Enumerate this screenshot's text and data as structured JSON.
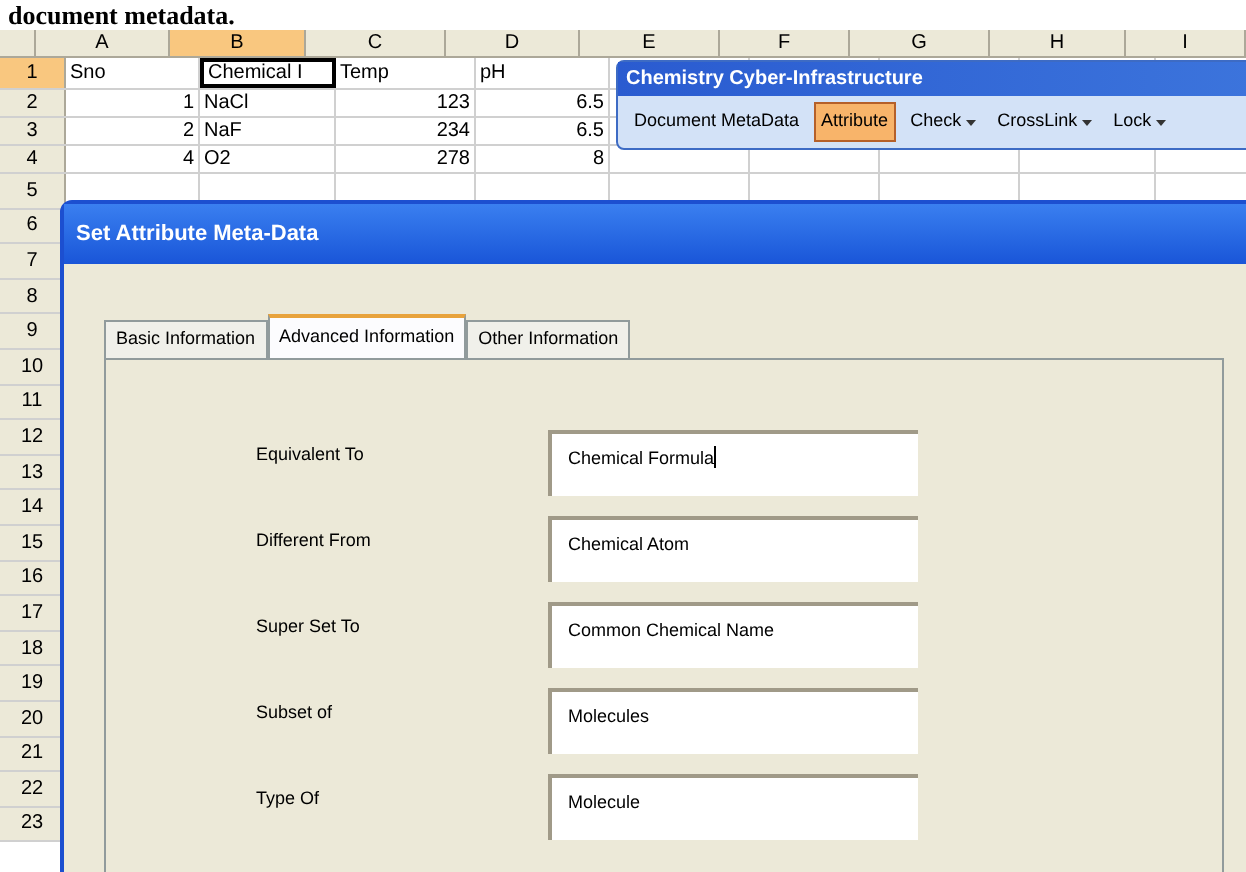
{
  "caption": "document metadata.",
  "sheet": {
    "columns": [
      {
        "label": "A",
        "selected": false
      },
      {
        "label": "B",
        "selected": true
      },
      {
        "label": "C",
        "selected": false
      },
      {
        "label": "D",
        "selected": false
      },
      {
        "label": "E",
        "selected": false
      },
      {
        "label": "F",
        "selected": false
      },
      {
        "label": "G",
        "selected": false
      },
      {
        "label": "H",
        "selected": false
      },
      {
        "label": "I",
        "selected": false
      }
    ],
    "rows": [
      {
        "number": "1",
        "selected": true,
        "cells": [
          {
            "text": "Sno",
            "kind": "text",
            "active": false
          },
          {
            "text": "Chemical I",
            "kind": "text",
            "active": true
          },
          {
            "text": "Temp",
            "kind": "text",
            "active": false
          },
          {
            "text": "pH",
            "kind": "text",
            "active": false
          }
        ]
      },
      {
        "number": "2",
        "selected": false,
        "cells": [
          {
            "text": "1",
            "kind": "number",
            "active": false
          },
          {
            "text": "NaCl",
            "kind": "text",
            "active": false
          },
          {
            "text": "123",
            "kind": "number",
            "active": false
          },
          {
            "text": "6.5",
            "kind": "number",
            "active": false
          }
        ]
      },
      {
        "number": "3",
        "selected": false,
        "cells": [
          {
            "text": "2",
            "kind": "number",
            "active": false
          },
          {
            "text": "NaF",
            "kind": "text",
            "active": false
          },
          {
            "text": "234",
            "kind": "number",
            "active": false
          },
          {
            "text": "6.5",
            "kind": "number",
            "active": false
          }
        ]
      },
      {
        "number": "4",
        "selected": false,
        "cells": [
          {
            "text": "4",
            "kind": "number",
            "active": false
          },
          {
            "text": "O2",
            "kind": "text",
            "active": false
          },
          {
            "text": "278",
            "kind": "number",
            "active": false
          },
          {
            "text": "8",
            "kind": "number",
            "active": false
          }
        ]
      },
      {
        "number": "5",
        "selected": false
      },
      {
        "number": "6",
        "selected": false
      },
      {
        "number": "7",
        "selected": false
      },
      {
        "number": "8",
        "selected": false
      },
      {
        "number": "9",
        "selected": false
      },
      {
        "number": "10",
        "selected": false
      },
      {
        "number": "11",
        "selected": false
      },
      {
        "number": "12",
        "selected": false
      },
      {
        "number": "13",
        "selected": false
      },
      {
        "number": "14",
        "selected": false
      },
      {
        "number": "15",
        "selected": false
      },
      {
        "number": "16",
        "selected": false
      },
      {
        "number": "17",
        "selected": false
      },
      {
        "number": "18",
        "selected": false
      },
      {
        "number": "19",
        "selected": false
      },
      {
        "number": "20",
        "selected": false
      },
      {
        "number": "21",
        "selected": false
      },
      {
        "number": "22",
        "selected": false
      },
      {
        "number": "23",
        "selected": false
      }
    ]
  },
  "toolbar": {
    "title": "Chemistry Cyber-Infrastructure",
    "buttons": [
      {
        "label": "Document MetaData",
        "selected": false,
        "dropdown": false
      },
      {
        "label": "Attribute",
        "selected": true,
        "dropdown": false
      },
      {
        "label": "Check",
        "selected": false,
        "dropdown": true
      },
      {
        "label": "CrossLink",
        "selected": false,
        "dropdown": true
      },
      {
        "label": "Lock",
        "selected": false,
        "dropdown": true
      }
    ]
  },
  "dialog": {
    "title": "Set Attribute Meta-Data",
    "tabs": [
      {
        "label": "Basic Information",
        "selected": false
      },
      {
        "label": "Advanced Information",
        "selected": true
      },
      {
        "label": "Other Information",
        "selected": false
      }
    ],
    "fields": [
      {
        "label": "Equivalent To",
        "value": "Chemical Formula",
        "focused": true
      },
      {
        "label": "Different From",
        "value": "Chemical Atom",
        "focused": false
      },
      {
        "label": "Super Set To",
        "value": "Common Chemical Name",
        "focused": false
      },
      {
        "label": "Subset of",
        "value": "Molecules",
        "focused": false
      },
      {
        "label": "Type Of",
        "value": "Molecule",
        "focused": false
      }
    ]
  }
}
